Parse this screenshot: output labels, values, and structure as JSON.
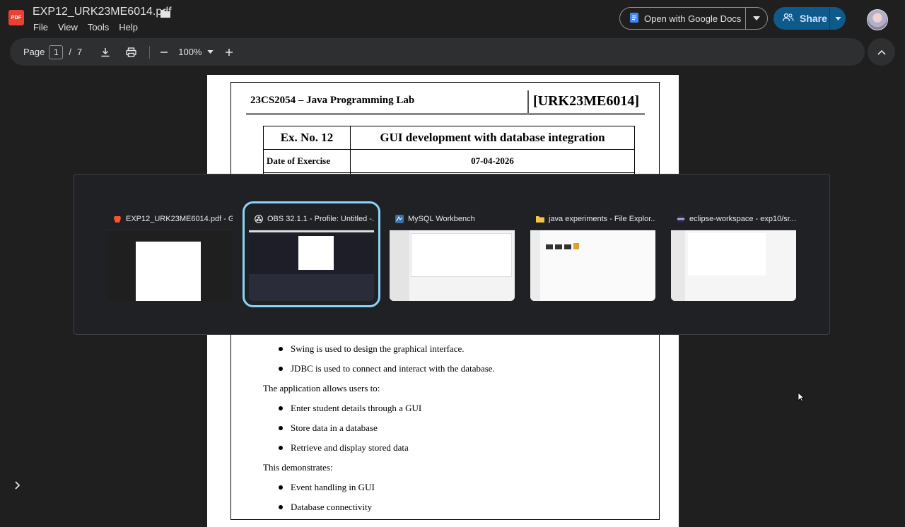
{
  "header": {
    "pdf_badge": "PDF",
    "doc_title": "EXP12_URK23ME6014.pdf",
    "menu": [
      "File",
      "View",
      "Tools",
      "Help"
    ],
    "open_with_label": "Open with Google Docs",
    "share_label": "Share"
  },
  "toolbar": {
    "page_label": "Page",
    "page_current": "1",
    "page_separator": "/",
    "page_total": "7",
    "zoom": "100%"
  },
  "document": {
    "course": "23CS2054 – Java Programming Lab",
    "reg_no": "[URK23ME6014]",
    "ex_no": "Ex. No. 12",
    "ex_title": "GUI development with database integration",
    "date_label": "Date of Exercise",
    "date_value": "07-04-2026",
    "lines": [
      "Swing is used to design the graphical interface.",
      "JDBC is used to connect and interact with the database.",
      "The application allows users to:",
      "Enter student details through a GUI",
      "Store data in a database",
      "Retrieve and display stored data",
      "This demonstrates:",
      "Event handling in GUI",
      "Database connectivity"
    ]
  },
  "task_switcher": {
    "windows": [
      {
        "title": "EXP12_URK23ME6014.pdf - G...",
        "icon": "brave-browser-icon",
        "selected": false
      },
      {
        "title": "OBS 32.1.1 - Profile: Untitled -...",
        "icon": "obs-icon",
        "selected": true
      },
      {
        "title": "MySQL Workbench",
        "icon": "mysql-workbench-icon",
        "selected": false
      },
      {
        "title": "java experiments - File Explor...",
        "icon": "folder-icon",
        "selected": false
      },
      {
        "title": "eclipse-workspace - exp10/sr...",
        "icon": "eclipse-icon",
        "selected": false
      }
    ]
  },
  "colors": {
    "background": "#1f1f1f",
    "toolbar": "#2d2f31",
    "share_button": "#0e5a8a",
    "selection_outline": "#8ad4f8",
    "pdf_badge": "#e94235"
  }
}
